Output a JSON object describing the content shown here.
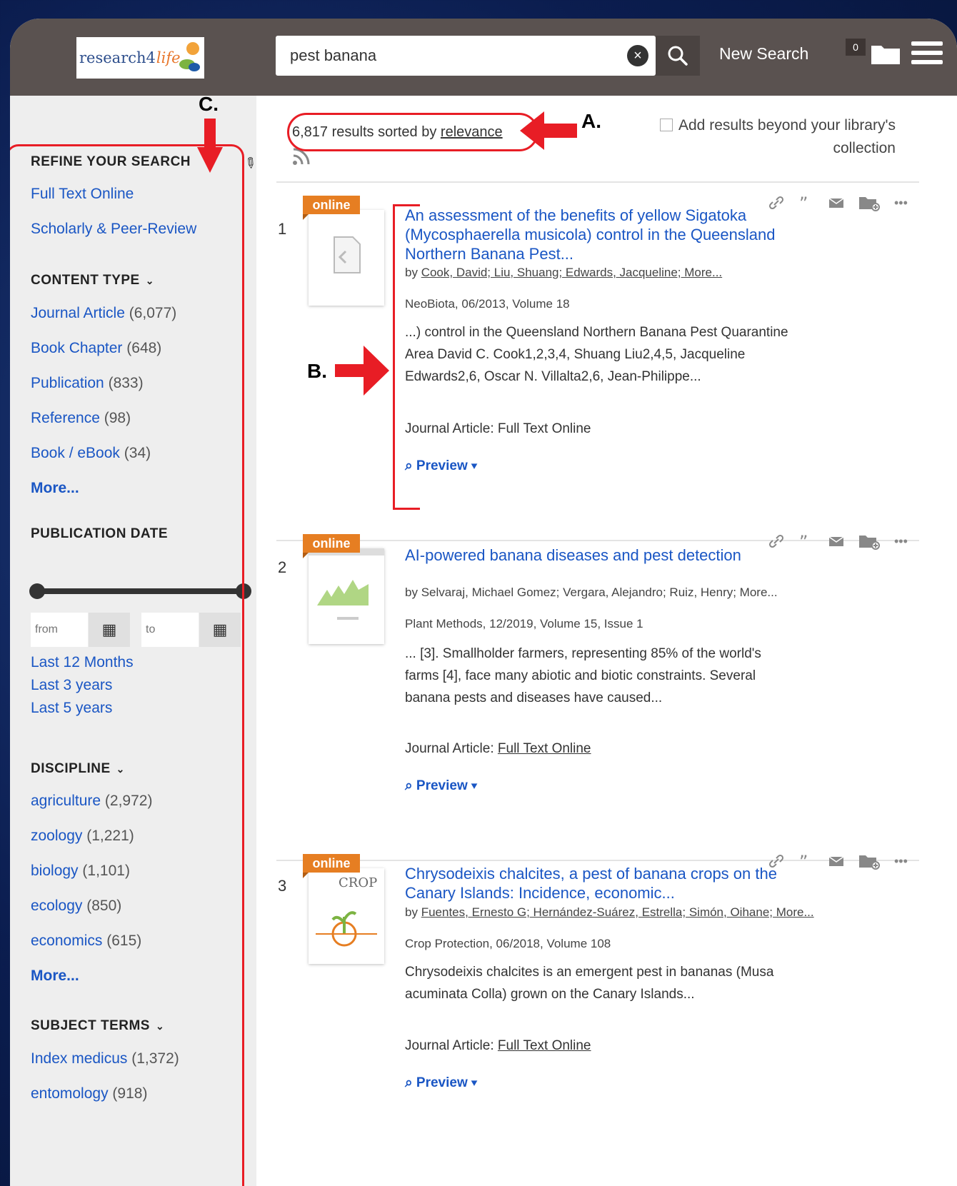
{
  "header": {
    "logo_text_a": "research4",
    "logo_text_b": "life",
    "search_value": "pest banana",
    "new_search_label": "New Search",
    "saved_count": "0"
  },
  "sidebar": {
    "refine_heading": "REFINE YOUR SEARCH",
    "availability": [
      "Full Text Online",
      "Scholarly & Peer-Review"
    ],
    "content_type": {
      "heading": "CONTENT TYPE",
      "items": [
        {
          "label": "Journal Article",
          "count": "(6,077)"
        },
        {
          "label": "Book Chapter",
          "count": "(648)"
        },
        {
          "label": "Publication",
          "count": "(833)"
        },
        {
          "label": "Reference",
          "count": "(98)"
        },
        {
          "label": "Book / eBook",
          "count": "(34)"
        }
      ],
      "more": "More..."
    },
    "publication_date": {
      "heading": "PUBLICATION DATE",
      "from_placeholder": "from",
      "to_placeholder": "to",
      "presets": [
        "Last 12 Months",
        "Last 3 years",
        "Last 5 years"
      ]
    },
    "discipline": {
      "heading": "DISCIPLINE",
      "items": [
        {
          "label": "agriculture",
          "count": "(2,972)"
        },
        {
          "label": "zoology",
          "count": "(1,221)"
        },
        {
          "label": "biology",
          "count": "(1,101)"
        },
        {
          "label": "ecology",
          "count": "(850)"
        },
        {
          "label": "economics",
          "count": "(615)"
        }
      ],
      "more": "More..."
    },
    "subject_terms": {
      "heading": "SUBJECT TERMS",
      "items": [
        {
          "label": "Index medicus",
          "count": "(1,372)"
        },
        {
          "label": "entomology",
          "count": "(918)"
        }
      ]
    }
  },
  "results": {
    "summary_prefix": "6,817 results sorted by",
    "sort_by": "relevance",
    "add_beyond": "Add results beyond your library's collection",
    "online_label": "online",
    "preview_label": "Preview",
    "items": [
      {
        "rank": "1",
        "title": "An assessment of the benefits of yellow Sigatoka (Mycosphaerella musicola) control in the Queensland Northern Banana Pest...",
        "authors_prefix": "by",
        "authors": "Cook, David; Liu, Shuang; Edwards, Jacqueline; More...",
        "pubinfo": "NeoBiota, 06/2013, Volume 18",
        "snippet": "...) control in the Queensland Northern Banana Pest Quarantine Area David C. Cook1,2,3,4, Shuang Liu2,4,5, Jacqueline Edwards2,6, Oscar N. Villalta2,6, Jean-Philippe...",
        "doctype": "Journal Article:",
        "access": "Full Text Online"
      },
      {
        "rank": "2",
        "title": "AI-powered banana diseases and pest detection",
        "authors_prefix": "by",
        "authors": "Selvaraj, Michael Gomez; Vergara, Alejandro; Ruiz, Henry; More...",
        "pubinfo": "Plant Methods, 12/2019, Volume 15, Issue 1",
        "snippet": "... [3]. Smallholder farmers, representing 85% of the world's farms [4], face many abiotic and biotic constraints. Several banana pests and diseases have caused...",
        "doctype": "Journal Article:",
        "access": "Full Text Online"
      },
      {
        "rank": "3",
        "title": "Chrysodeixis chalcites, a pest of banana crops on the Canary Islands: Incidence, economic...",
        "authors_prefix": "by",
        "authors": "Fuentes, Ernesto G; Hernández-Suárez, Estrella; Simón, Oihane; More...",
        "pubinfo": "Crop Protection, 06/2018, Volume 108",
        "snippet": "Chrysodeixis chalcites is an emergent pest in bananas (Musa acuminata Colla) grown on the Canary Islands...",
        "doctype": "Journal Article:",
        "access": "Full Text Online"
      }
    ]
  },
  "annotations": {
    "a": "A.",
    "b": "B.",
    "c": "C."
  },
  "colors": {
    "accent": "#1a56c4",
    "online": "#e67e22",
    "annotation": "#e81d25",
    "header": "#5a5250"
  }
}
